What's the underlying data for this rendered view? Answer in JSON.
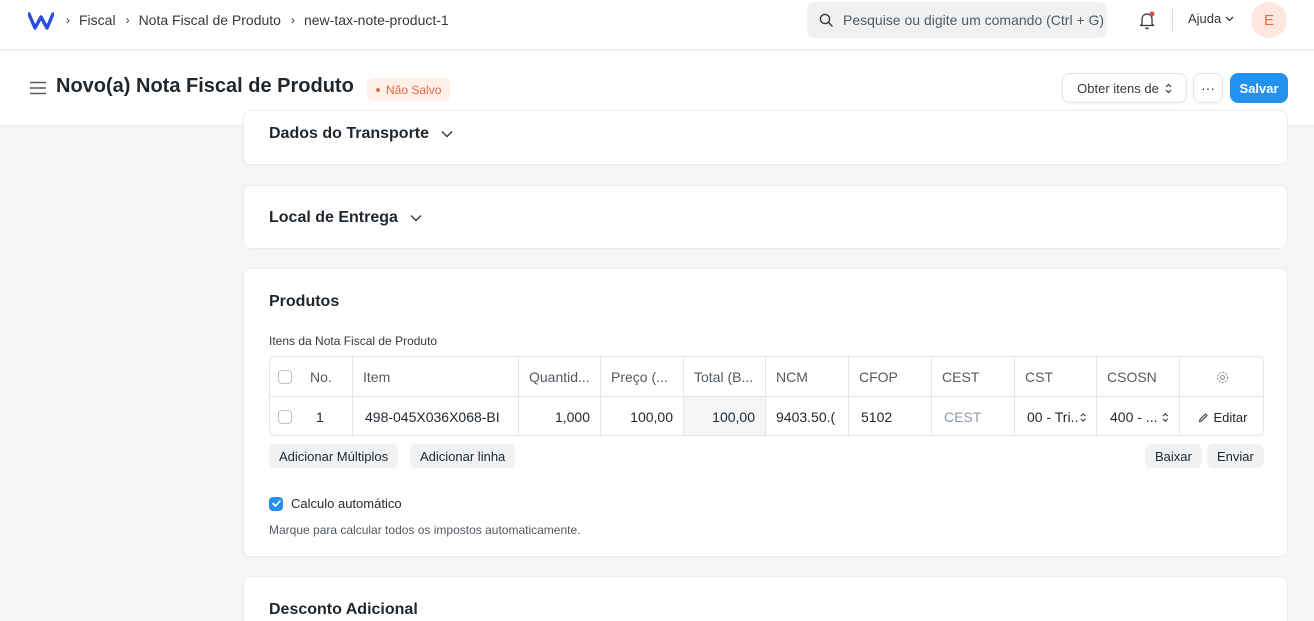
{
  "navbar": {
    "breadcrumbs": [
      "Fiscal",
      "Nota Fiscal de Produto",
      "new-tax-note-product-1"
    ],
    "search_placeholder": "Pesquise ou digite um comando (Ctrl + G)",
    "help_label": "Ajuda",
    "avatar_initial": "E"
  },
  "page": {
    "title": "Novo(a) Nota Fiscal de Produto",
    "status_badge": "Não Salvo",
    "get_items_label": "Obter itens de",
    "more_label": "···",
    "save_label": "Salvar"
  },
  "sections": {
    "transport_title": "Dados do Transporte",
    "delivery_title": "Local de Entrega",
    "products_title": "Produtos",
    "discount_title": "Desconto Adicional"
  },
  "products": {
    "grid_label": "Itens da Nota Fiscal de Produto",
    "headers": [
      "No.",
      "Item",
      "Quantid...",
      "Preço (...",
      "Total (B...",
      "NCM",
      "CFOP",
      "CEST",
      "CST",
      "CSOSN"
    ],
    "row": {
      "no": "1",
      "item": "498-045X036X068-BI",
      "quantity": "1,000",
      "price": "100,00",
      "total": "100,00",
      "ncm": "9403.50.(",
      "cfop": "5102",
      "cest": "CEST",
      "cst": "00 - Tri...",
      "csosn": "400 - ...",
      "edit_label": "Editar"
    },
    "add_multiple_label": "Adicionar Múltiplos",
    "add_row_label": "Adicionar linha",
    "download_label": "Baixar",
    "upload_label": "Enviar",
    "auto_calc_label": "Calculo automático",
    "auto_calc_checked": true,
    "auto_calc_desc": "Marque para calcular todos os impostos automaticamente."
  },
  "colors": {
    "primary": "#2490ef",
    "badge_text": "#e36d43",
    "badge_bg": "#fff0ea",
    "logo": "#2a4ddb"
  }
}
